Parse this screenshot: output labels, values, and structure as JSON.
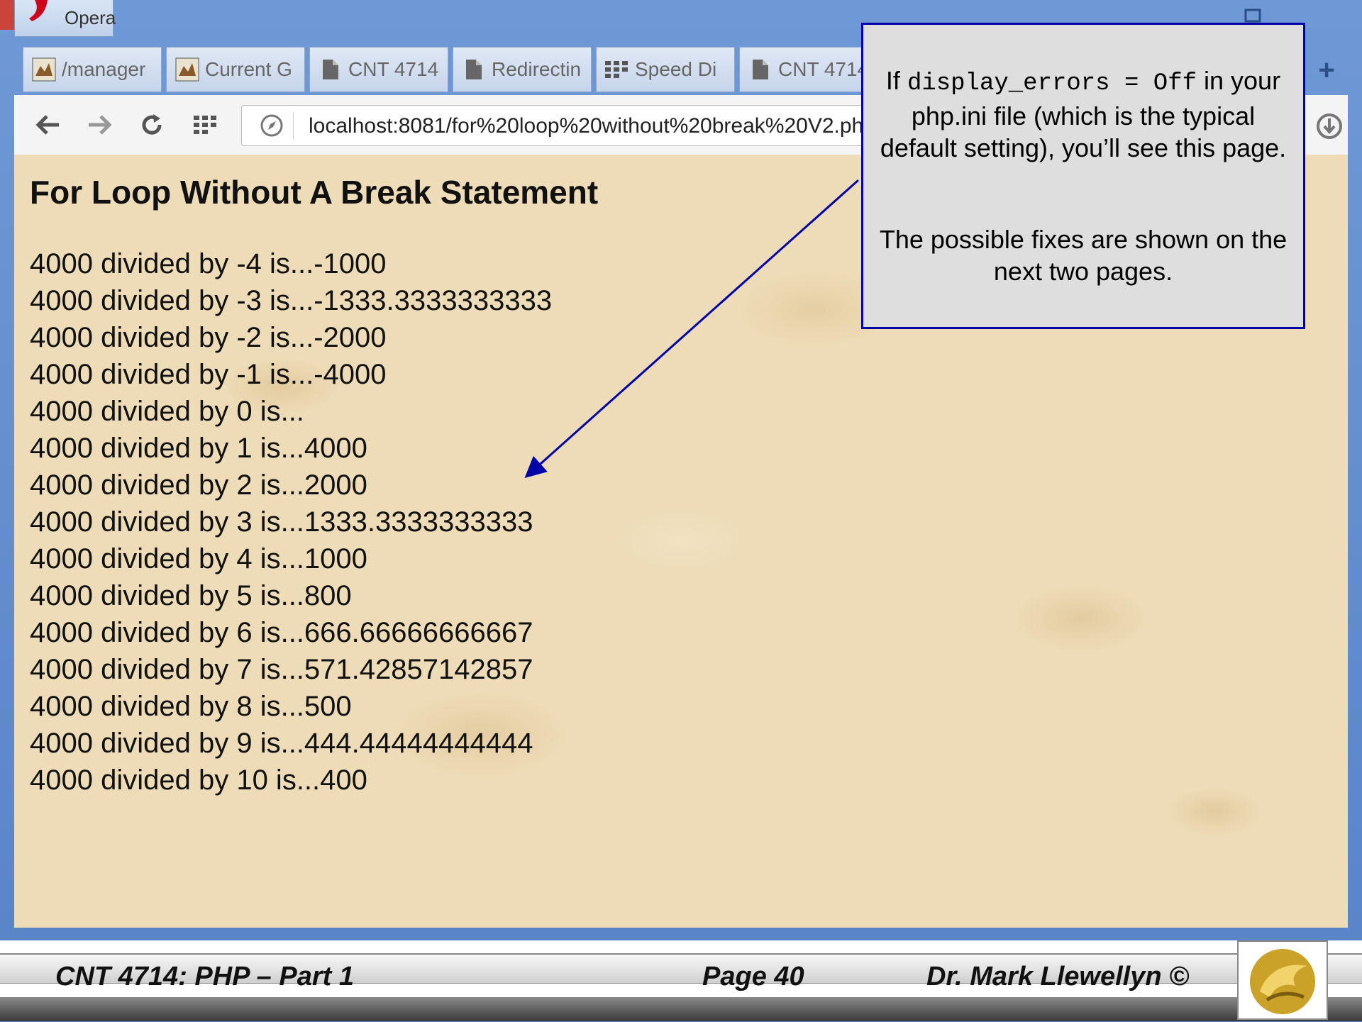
{
  "window": {
    "app_label": "Opera",
    "close_glyph": "✕"
  },
  "tabs": [
    {
      "label": "/manager",
      "icon": "tomcat-icon"
    },
    {
      "label": "Current G",
      "icon": "tomcat-icon"
    },
    {
      "label": "CNT 4714",
      "icon": "page-icon"
    },
    {
      "label": "Redirectin",
      "icon": "page-icon"
    },
    {
      "label": "Speed Di",
      "icon": "speed-dial-icon"
    },
    {
      "label": "CNT 4714",
      "icon": "page-icon"
    }
  ],
  "new_tab_glyph": "+",
  "address_bar": {
    "url": "localhost:8081/for%20loop%20without%20break%20V2.ph"
  },
  "page": {
    "title": "For Loop Without A Break Statement",
    "results": [
      "4000 divided by -4 is...-1000",
      "4000 divided by -3 is...-1333.3333333333",
      "4000 divided by -2 is...-2000",
      "4000 divided by -1 is...-4000",
      "4000 divided by 0 is...",
      "4000 divided by 1 is...4000",
      "4000 divided by 2 is...2000",
      "4000 divided by 3 is...1333.3333333333",
      "4000 divided by 4 is...1000",
      "4000 divided by 5 is...800",
      "4000 divided by 6 is...666.66666666667",
      "4000 divided by 7 is...571.42857142857",
      "4000 divided by 8 is...500",
      "4000 divided by 9 is...444.44444444444",
      "4000 divided by 10 is...400"
    ]
  },
  "callout": {
    "p1_pre": "If ",
    "p1_code": "display_errors = Off",
    "p1_post": " in your php.ini file (which is the typical default setting), you’ll see this page.",
    "p2": "The possible fixes are shown on the next two pages."
  },
  "footer": {
    "course": "CNT 4714:  PHP – Part 1",
    "page": "Page 40",
    "author": "Dr. Mark Llewellyn ©"
  },
  "colors": {
    "callout_border": "#0000a8",
    "arrow": "#0000a8",
    "titlebar": "#6f98d6",
    "close_button": "#c9453b",
    "page_background": "#eedcb8",
    "logo_gold": "#c9a227"
  }
}
